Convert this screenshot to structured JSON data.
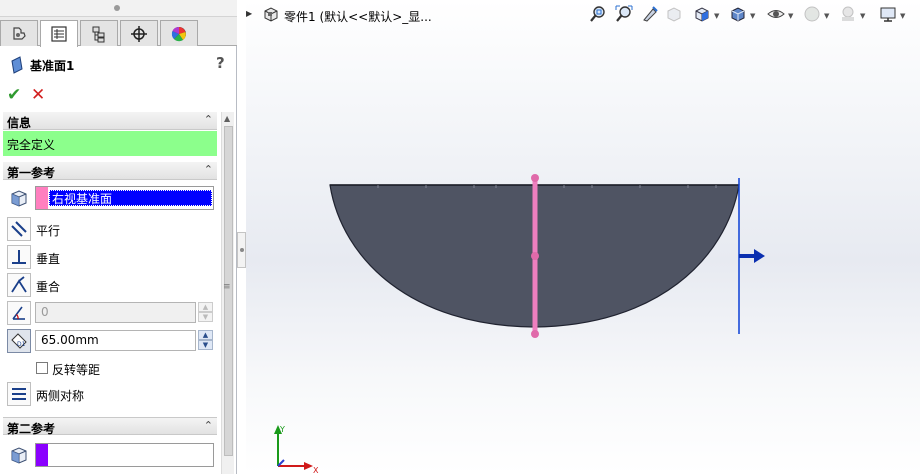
{
  "window": {
    "part_label": "零件1  (默认<<默认>_显..."
  },
  "property_manager": {
    "tabs": [
      {
        "name": "feature-manager",
        "icon": "feature-tree-icon"
      },
      {
        "name": "property-manager",
        "icon": "property-manager-icon"
      },
      {
        "name": "configuration-manager",
        "icon": "configuration-icon"
      },
      {
        "name": "dimxpert-manager",
        "icon": "crosshair-icon"
      },
      {
        "name": "display-manager",
        "icon": "appearance-icon"
      }
    ],
    "title": "基准面1",
    "help": "?",
    "ok_icon": "checkmark-icon",
    "cancel_icon": "x-icon",
    "info_section": {
      "label": "信息",
      "message": "完全定义",
      "message_color": "#8cff8c"
    },
    "first_reference": {
      "label": "第一参考",
      "selection": "右视基准面",
      "swatch_color": "#ff7fbf",
      "options": [
        {
          "label": "平行",
          "icon": "parallel-icon"
        },
        {
          "label": "垂直",
          "icon": "perpendicular-icon"
        },
        {
          "label": "重合",
          "icon": "coincident-icon"
        }
      ],
      "angle_value": "0",
      "distance_value": "65.00mm",
      "flip_label": "反转等距",
      "symmetric_label": "两侧对称"
    },
    "second_reference": {
      "label": "第二参考",
      "swatch_color": "#8a00ff"
    }
  },
  "view_toolbar": {
    "icons": [
      "zoom-to-fit-icon",
      "zoom-area-icon",
      "previous-view-icon",
      "section-view-icon",
      "view-orientation-icon",
      "display-style-icon",
      "hide-show-icon",
      "edit-appearance-icon",
      "scene-icon",
      "view-settings-icon"
    ]
  },
  "triad": {
    "x_label": "X",
    "y_label": "Y"
  },
  "colors": {
    "part_body": "#4f5463",
    "reference_plane": "#ee7fbf",
    "offset_plane": "#0b3fd6"
  }
}
